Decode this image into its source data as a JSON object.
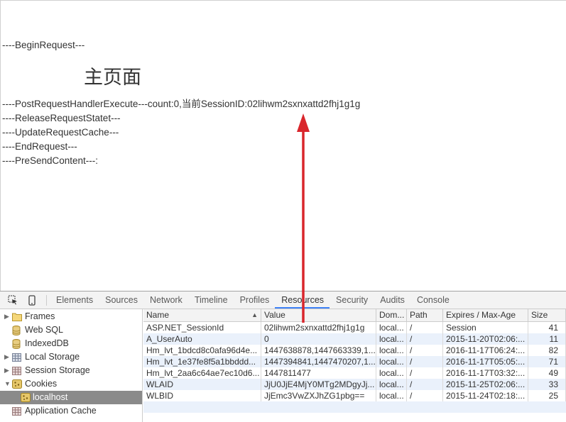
{
  "page": {
    "log_lines": [
      "----BeginRequest---",
      "----PostRequestHandlerExecute---count:0,当前SessionID:02lihwm2sxnxattd2fhj1g1g",
      "----ReleaseRequestStatet---",
      "----UpdateRequestCache---",
      "----EndRequest---",
      "----PreSendContent---:"
    ],
    "main_title": "主页面"
  },
  "devtools": {
    "tools": {
      "inspect_icon": "inspect-element-icon",
      "device_icon": "device-mode-icon"
    },
    "tabs": [
      {
        "label": "Elements"
      },
      {
        "label": "Sources"
      },
      {
        "label": "Network"
      },
      {
        "label": "Timeline"
      },
      {
        "label": "Profiles"
      },
      {
        "label": "Resources"
      },
      {
        "label": "Security"
      },
      {
        "label": "Audits"
      },
      {
        "label": "Console"
      }
    ],
    "active_tab": "Resources",
    "sidebar": [
      {
        "label": "Frames",
        "icon": "folder-icon",
        "expanded": false
      },
      {
        "label": "Web SQL",
        "icon": "database-icon"
      },
      {
        "label": "IndexedDB",
        "icon": "database-icon"
      },
      {
        "label": "Local Storage",
        "icon": "table-icon",
        "expanded": false
      },
      {
        "label": "Session Storage",
        "icon": "table-icon",
        "expanded": false
      },
      {
        "label": "Cookies",
        "icon": "cookie-icon",
        "expanded": true
      },
      {
        "label": "localhost",
        "icon": "cookie-icon",
        "selected": true
      },
      {
        "label": "Application Cache",
        "icon": "table-icon"
      }
    ],
    "columns": [
      "Name",
      "Value",
      "Dom...",
      "Path",
      "Expires / Max-Age",
      "Size"
    ],
    "rows": [
      [
        "ASP.NET_SessionId",
        "02lihwm2sxnxattd2fhj1g1g",
        "local...",
        "/",
        "Session",
        "41"
      ],
      [
        "A_UserAuto",
        "0",
        "local...",
        "/",
        "2015-11-20T02:06:...",
        "11"
      ],
      [
        "Hm_lvt_1bdcd8c0afa96d4e...",
        "1447638878,1447663339,1...",
        "local...",
        "/",
        "2016-11-17T06:24:...",
        "82"
      ],
      [
        "Hm_lvt_1e37fe8f5a1bbddd...",
        "1447394841,1447470207,1...",
        "local...",
        "/",
        "2016-11-17T05:05:...",
        "71"
      ],
      [
        "Hm_lvt_2aa6c64ae7ec10d6...",
        "1447811477",
        "local...",
        "/",
        "2016-11-17T03:32:...",
        "49"
      ],
      [
        "WLAID",
        "JjU0JjE4MjY0MTg2MDgyJj...",
        "local...",
        "/",
        "2015-11-25T02:06:...",
        "33"
      ],
      [
        "WLBID",
        "JjEmc3VwZXJhZG1pbg==",
        "local...",
        "/",
        "2015-11-24T02:18:...",
        "25"
      ]
    ]
  },
  "colors": {
    "annotation_arrow": "#d9262c",
    "active_tab_underline": "#3e82f7",
    "selected_row": "#8a8a8a"
  }
}
